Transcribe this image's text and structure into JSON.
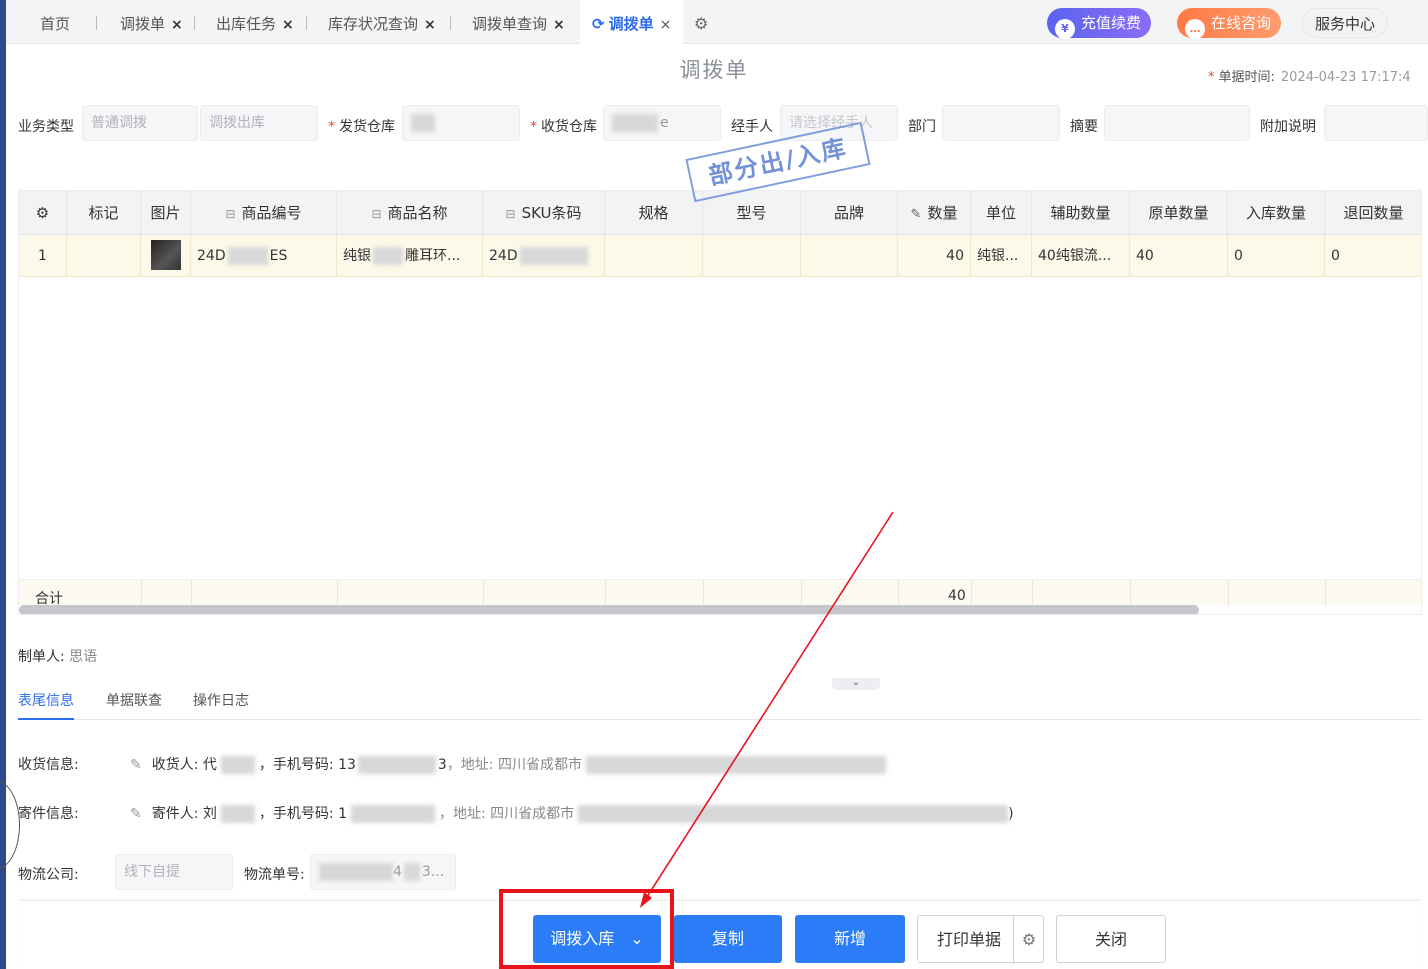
{
  "tabs": {
    "items": [
      {
        "label": "首页"
      },
      {
        "label": "调拨单"
      },
      {
        "label": "出库任务"
      },
      {
        "label": "库存状况查询"
      },
      {
        "label": "调拨单查询"
      },
      {
        "label": "调拨单"
      }
    ],
    "close_glyph": "×",
    "active_refresh_glyph": "⟳",
    "settings_glyph": "⚙",
    "recharge": "充值续费",
    "consult": "在线咨询",
    "service": "服务中心"
  },
  "page": {
    "title": "调拨单",
    "doc_time_label": "单据时间:",
    "doc_time_value": "2024-04-23 17:17:4"
  },
  "form": {
    "business_type_label": "业务类型",
    "business_type_value": "普通调拨",
    "transfer_mode_value": "调拨出库",
    "ship_warehouse_label": "发货仓库",
    "receive_warehouse_label": "收货仓库",
    "receive_warehouse_suffix": "e",
    "handler_label": "经手人",
    "handler_placeholder": "请选择经手人",
    "dept_label": "部门",
    "summary_label": "摘要",
    "remark_label": "附加说明"
  },
  "stamp": "部分出/入库",
  "table": {
    "headers": [
      "⚙",
      "标记",
      "图片",
      "商品编号",
      "商品名称",
      "SKU条码",
      "规格",
      "型号",
      "品牌",
      "数量",
      "单位",
      "辅助数量",
      "原单数量",
      "入库数量",
      "退回数量"
    ],
    "header_prefix_glyph": "⊟",
    "edit_glyph": "✎",
    "row": {
      "index": "1",
      "code_prefix": "24D",
      "code_suffix": "ES",
      "name_prefix": "纯银",
      "name_suffix": "雕耳环...",
      "sku_prefix": "24D",
      "qty": "40",
      "unit": "纯银...",
      "aux_qty": "40纯银流...",
      "orig_qty": "40",
      "in_qty": "0",
      "return_qty": "0"
    },
    "total_label": "合计",
    "total_qty": "40"
  },
  "maker": {
    "label": "制单人:",
    "value": "思语"
  },
  "collapse_glyph": "⌄",
  "sub_tabs": [
    "表尾信息",
    "单据联查",
    "操作日志"
  ],
  "receive_info": {
    "label": "收货信息:",
    "receiver_label": "收货人: 代",
    "phone_label": "，手机号码: 13",
    "phone_tail": "3",
    "address_label": "，地址: 四川省成都市"
  },
  "sender_info": {
    "label": "寄件信息:",
    "sender_label": "寄件人: 刘",
    "phone_label": "，手机号码: 1",
    "address_label": "，地址: 四川省成都市",
    "address_tail": ")"
  },
  "logistics": {
    "company_label": "物流公司:",
    "company_value": "线下自提",
    "tracking_label": "物流单号:",
    "tracking_mid": "4",
    "tracking_tail": "3..."
  },
  "buttons": {
    "transfer_in": "调拨入库",
    "dropdown_glyph": "⌄",
    "copy": "复制",
    "add": "新增",
    "print": "打印单据",
    "close": "关闭"
  },
  "colors": {
    "primary": "#2b7cf6",
    "annotation_red": "#e8141c",
    "active_tab": "#2d6cf0"
  }
}
